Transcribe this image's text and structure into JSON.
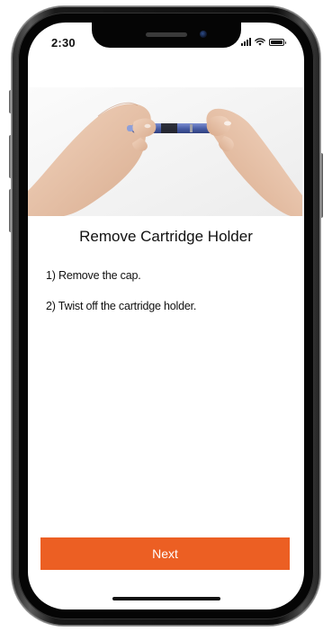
{
  "status_bar": {
    "time": "2:30",
    "signal_bars": 4,
    "wifi_icon": "wifi-icon",
    "battery_level": 1.0
  },
  "hero": {
    "image_icon": "hands-twisting-pen-image"
  },
  "screen": {
    "title": "Remove Cartridge Holder",
    "steps": [
      "1) Remove the cap.",
      "2) Twist off the cartridge holder."
    ]
  },
  "actions": {
    "next_label": "Next"
  },
  "colors": {
    "accent": "#ec5f23",
    "text": "#111111",
    "background": "#ffffff",
    "pen_body": "#4a5fa8"
  }
}
